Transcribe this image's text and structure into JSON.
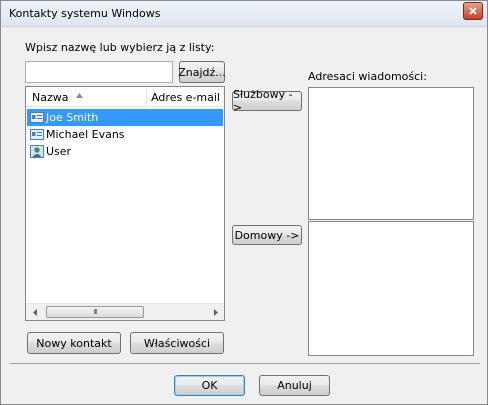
{
  "window": {
    "title": "Kontakty systemu Windows"
  },
  "search": {
    "prompt": "Wpisz nazwę lub wybierz ją z listy:",
    "value": "",
    "find_button": "Znajdź..."
  },
  "list": {
    "col_name": "Nazwa",
    "col_email": "Adres e-mail",
    "contacts": [
      {
        "name": "Joe Smith",
        "icon": "contact-card-icon",
        "selected": true
      },
      {
        "name": "Michael Evans",
        "icon": "contact-card-icon",
        "selected": false
      },
      {
        "name": "User",
        "icon": "user-contact-icon",
        "selected": false
      }
    ],
    "scroll_thumb_grip": "III"
  },
  "recipients": {
    "label": "Adresaci wiadomości:"
  },
  "buttons": {
    "business": "Służbowy ->",
    "home": "Domowy ->",
    "new_contact": "Nowy kontakt",
    "properties": "Właściwości",
    "ok": "OK",
    "cancel": "Anuluj"
  },
  "colors": {
    "selection": "#3399ff",
    "dialog_bg": "#f0f0f0",
    "close_button": "#c5412a"
  }
}
